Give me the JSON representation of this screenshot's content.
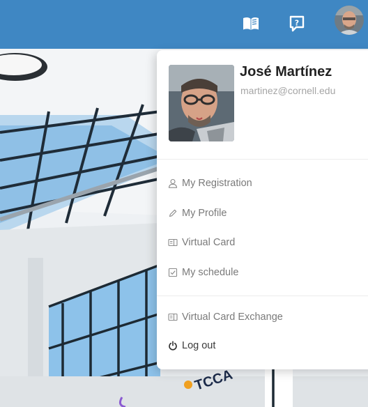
{
  "header": {
    "book_icon": "book-open-icon",
    "help_icon": "help-chat-icon",
    "avatar_icon": "user-avatar"
  },
  "user_menu": {
    "name": "José Martínez",
    "email": "martinez@cornell.edu",
    "sections": [
      {
        "items": [
          {
            "label": "My Registration",
            "icon": "user-icon"
          },
          {
            "label": "My Profile",
            "icon": "pencil-icon"
          },
          {
            "label": "Virtual Card",
            "icon": "card-icon"
          },
          {
            "label": "My schedule",
            "icon": "calendar-check-icon"
          }
        ]
      },
      {
        "items": [
          {
            "label": "Virtual Card Exchange",
            "icon": "card-icon"
          },
          {
            "label": "Log out",
            "icon": "power-icon"
          }
        ]
      }
    ]
  },
  "background": {
    "banner_text": "TCCA"
  },
  "colors": {
    "topbar": "#3f87c3",
    "menu_text": "#7a7a7a",
    "name_text": "#222222",
    "email_text": "#a5a5a5"
  }
}
